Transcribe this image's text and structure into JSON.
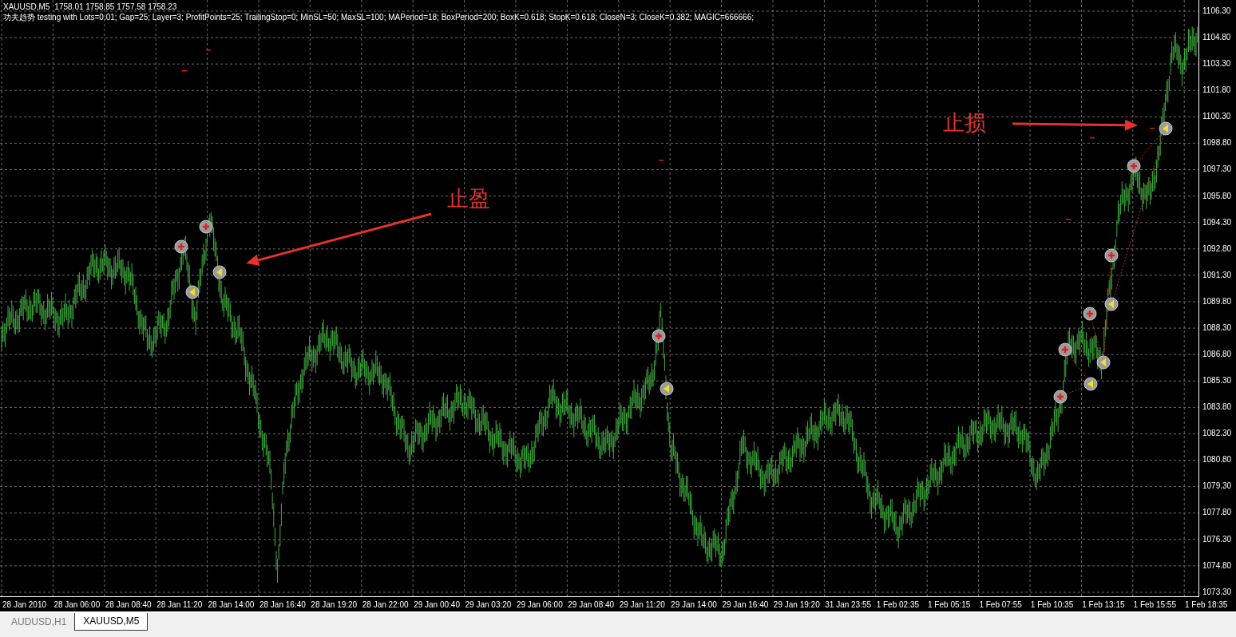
{
  "chart": {
    "symbol": "XAUUSD,M5",
    "ohlc": "1758.01 1758.85 1757.58 1758.23",
    "ea_info": "功夫趋势 testing with Lots=0.01; Gap=25; Layer=3; ProfitPoints=25; TrailingStop=0; MinSL=50; MaxSL=100; MAPeriod=18; BoxPeriod=200; BoxK=0.618; StopK=0.618; CloseN=3; CloseK=0.382; MAGIC=666666;",
    "annotations": [
      {
        "text": "止盈"
      },
      {
        "text": "止损"
      }
    ],
    "price_axis": [
      "1106.30",
      "1104.80",
      "1103.30",
      "1101.80",
      "1100.30",
      "1098.80",
      "1097.30",
      "1095.80",
      "1094.30",
      "1092.80",
      "1091.30",
      "1089.80",
      "1088.30",
      "1086.80",
      "1085.30",
      "1083.80",
      "1082.30",
      "1080.80",
      "1079.30",
      "1077.80",
      "1076.30",
      "1074.80",
      "1073.30"
    ],
    "time_axis": [
      "28 Jan 2010",
      "28 Jan 06:00",
      "28 Jan 08:40",
      "28 Jan 11:20",
      "28 Jan 14:00",
      "28 Jan 16:40",
      "28 Jan 19:20",
      "28 Jan 22:00",
      "29 Jan 00:40",
      "29 Jan 03:20",
      "29 Jan 06:00",
      "29 Jan 08:40",
      "29 Jan 11:20",
      "29 Jan 14:00",
      "29 Jan 16:40",
      "29 Jan 19:20",
      "31 Jan 23:55",
      "1 Feb 02:35",
      "1 Feb 05:15",
      "1 Feb 07:55",
      "1 Feb 10:35",
      "1 Feb 13:15",
      "1 Feb 15:55",
      "1 Feb 18:35"
    ]
  },
  "tabs": [
    {
      "label": "AUDUSD,H1",
      "selected": false
    },
    {
      "label": "XAUUSD,M5",
      "selected": true
    }
  ]
}
